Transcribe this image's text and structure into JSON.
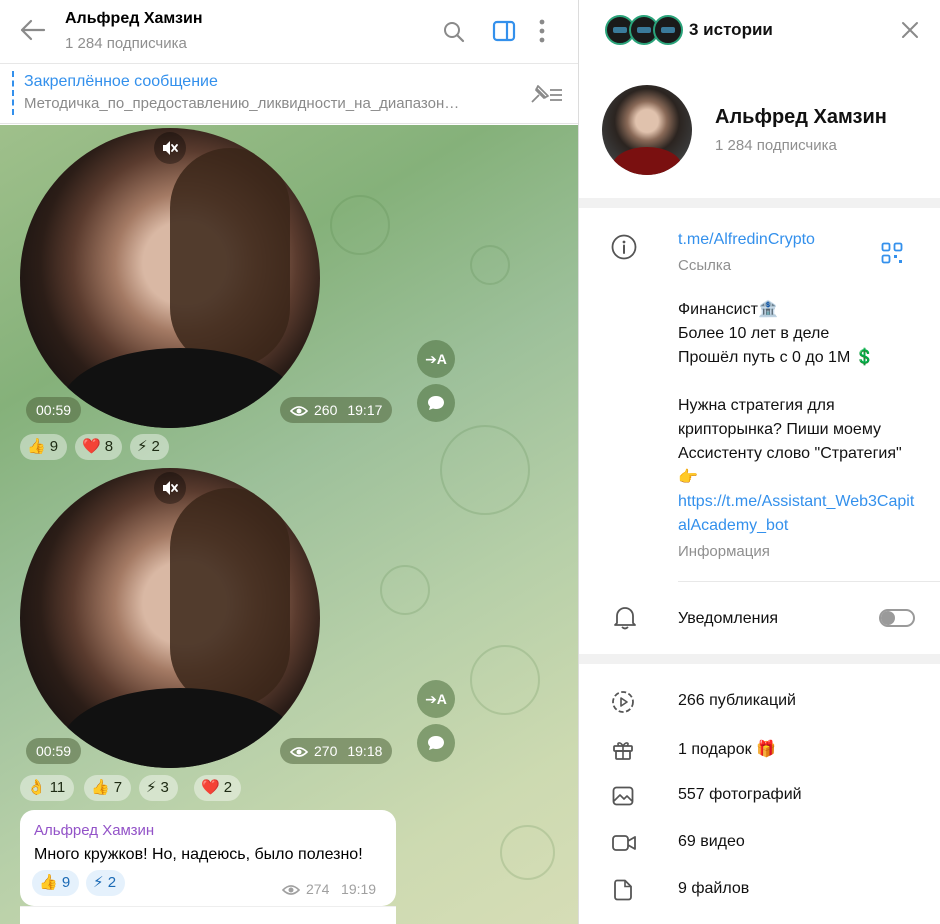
{
  "chat": {
    "title": "Альфред Хамзин",
    "subtitle": "1 284 подписчика",
    "pinned": {
      "title": "Закреплённое сообщение",
      "text": "Методичка_по_предоставлению_ликвидности_на_диапазон…"
    },
    "messages": [
      {
        "duration": "00:59",
        "views": "260",
        "time": "19:17",
        "translate_label": "➔A",
        "reactions": [
          {
            "emoji": "👍",
            "count": "9"
          },
          {
            "emoji": "❤️",
            "count": "8"
          },
          {
            "emoji": "⚡",
            "count": "2"
          }
        ]
      },
      {
        "duration": "00:59",
        "views": "270",
        "time": "19:18",
        "translate_label": "➔A",
        "reactions": [
          {
            "emoji": "👌",
            "count": "11"
          },
          {
            "emoji": "👍",
            "count": "7"
          },
          {
            "emoji": "⚡",
            "count": "3"
          },
          {
            "emoji": "❤️",
            "count": "2"
          }
        ]
      }
    ],
    "text_message": {
      "author": "Альфред Хамзин",
      "text": "Много кружков! Но, надеюсь, было полезно!",
      "views": "274",
      "time": "19:19",
      "reactions": [
        {
          "emoji": "👍",
          "count": "9"
        },
        {
          "emoji": "⚡",
          "count": "2"
        }
      ]
    }
  },
  "profile": {
    "stories_label": "3 истории",
    "name": "Альфред Хамзин",
    "subtitle": "1 284 подписчика",
    "link": "t.me/AlfredinCrypto",
    "link_caption": "Ссылка",
    "bio": "Финансист🏦\nБолее 10 лет в деле\nПрошёл путь с 0 до 1М 💲\n\nНужна стратегия для крипторынка? Пиши моему Ассистенту слово \"Стратегия\" 👉",
    "bio_link": "https://t.me/Assistant_Web3CapitalAcademy_bot",
    "bio_caption": "Информация",
    "notifications_label": "Уведомления",
    "notifications_on": false,
    "stats": [
      {
        "label": "266 публикаций",
        "icon": "stories-icon"
      },
      {
        "label": "1 подарок 🎁",
        "icon": "gift-icon"
      },
      {
        "label": "557 фотографий",
        "icon": "photo-icon"
      },
      {
        "label": "69 видео",
        "icon": "video-icon"
      },
      {
        "label": "9 файлов",
        "icon": "file-icon"
      }
    ]
  },
  "colors": {
    "accent": "#3390ec",
    "author": "#9353c8",
    "muted": "#8f8f8f"
  }
}
